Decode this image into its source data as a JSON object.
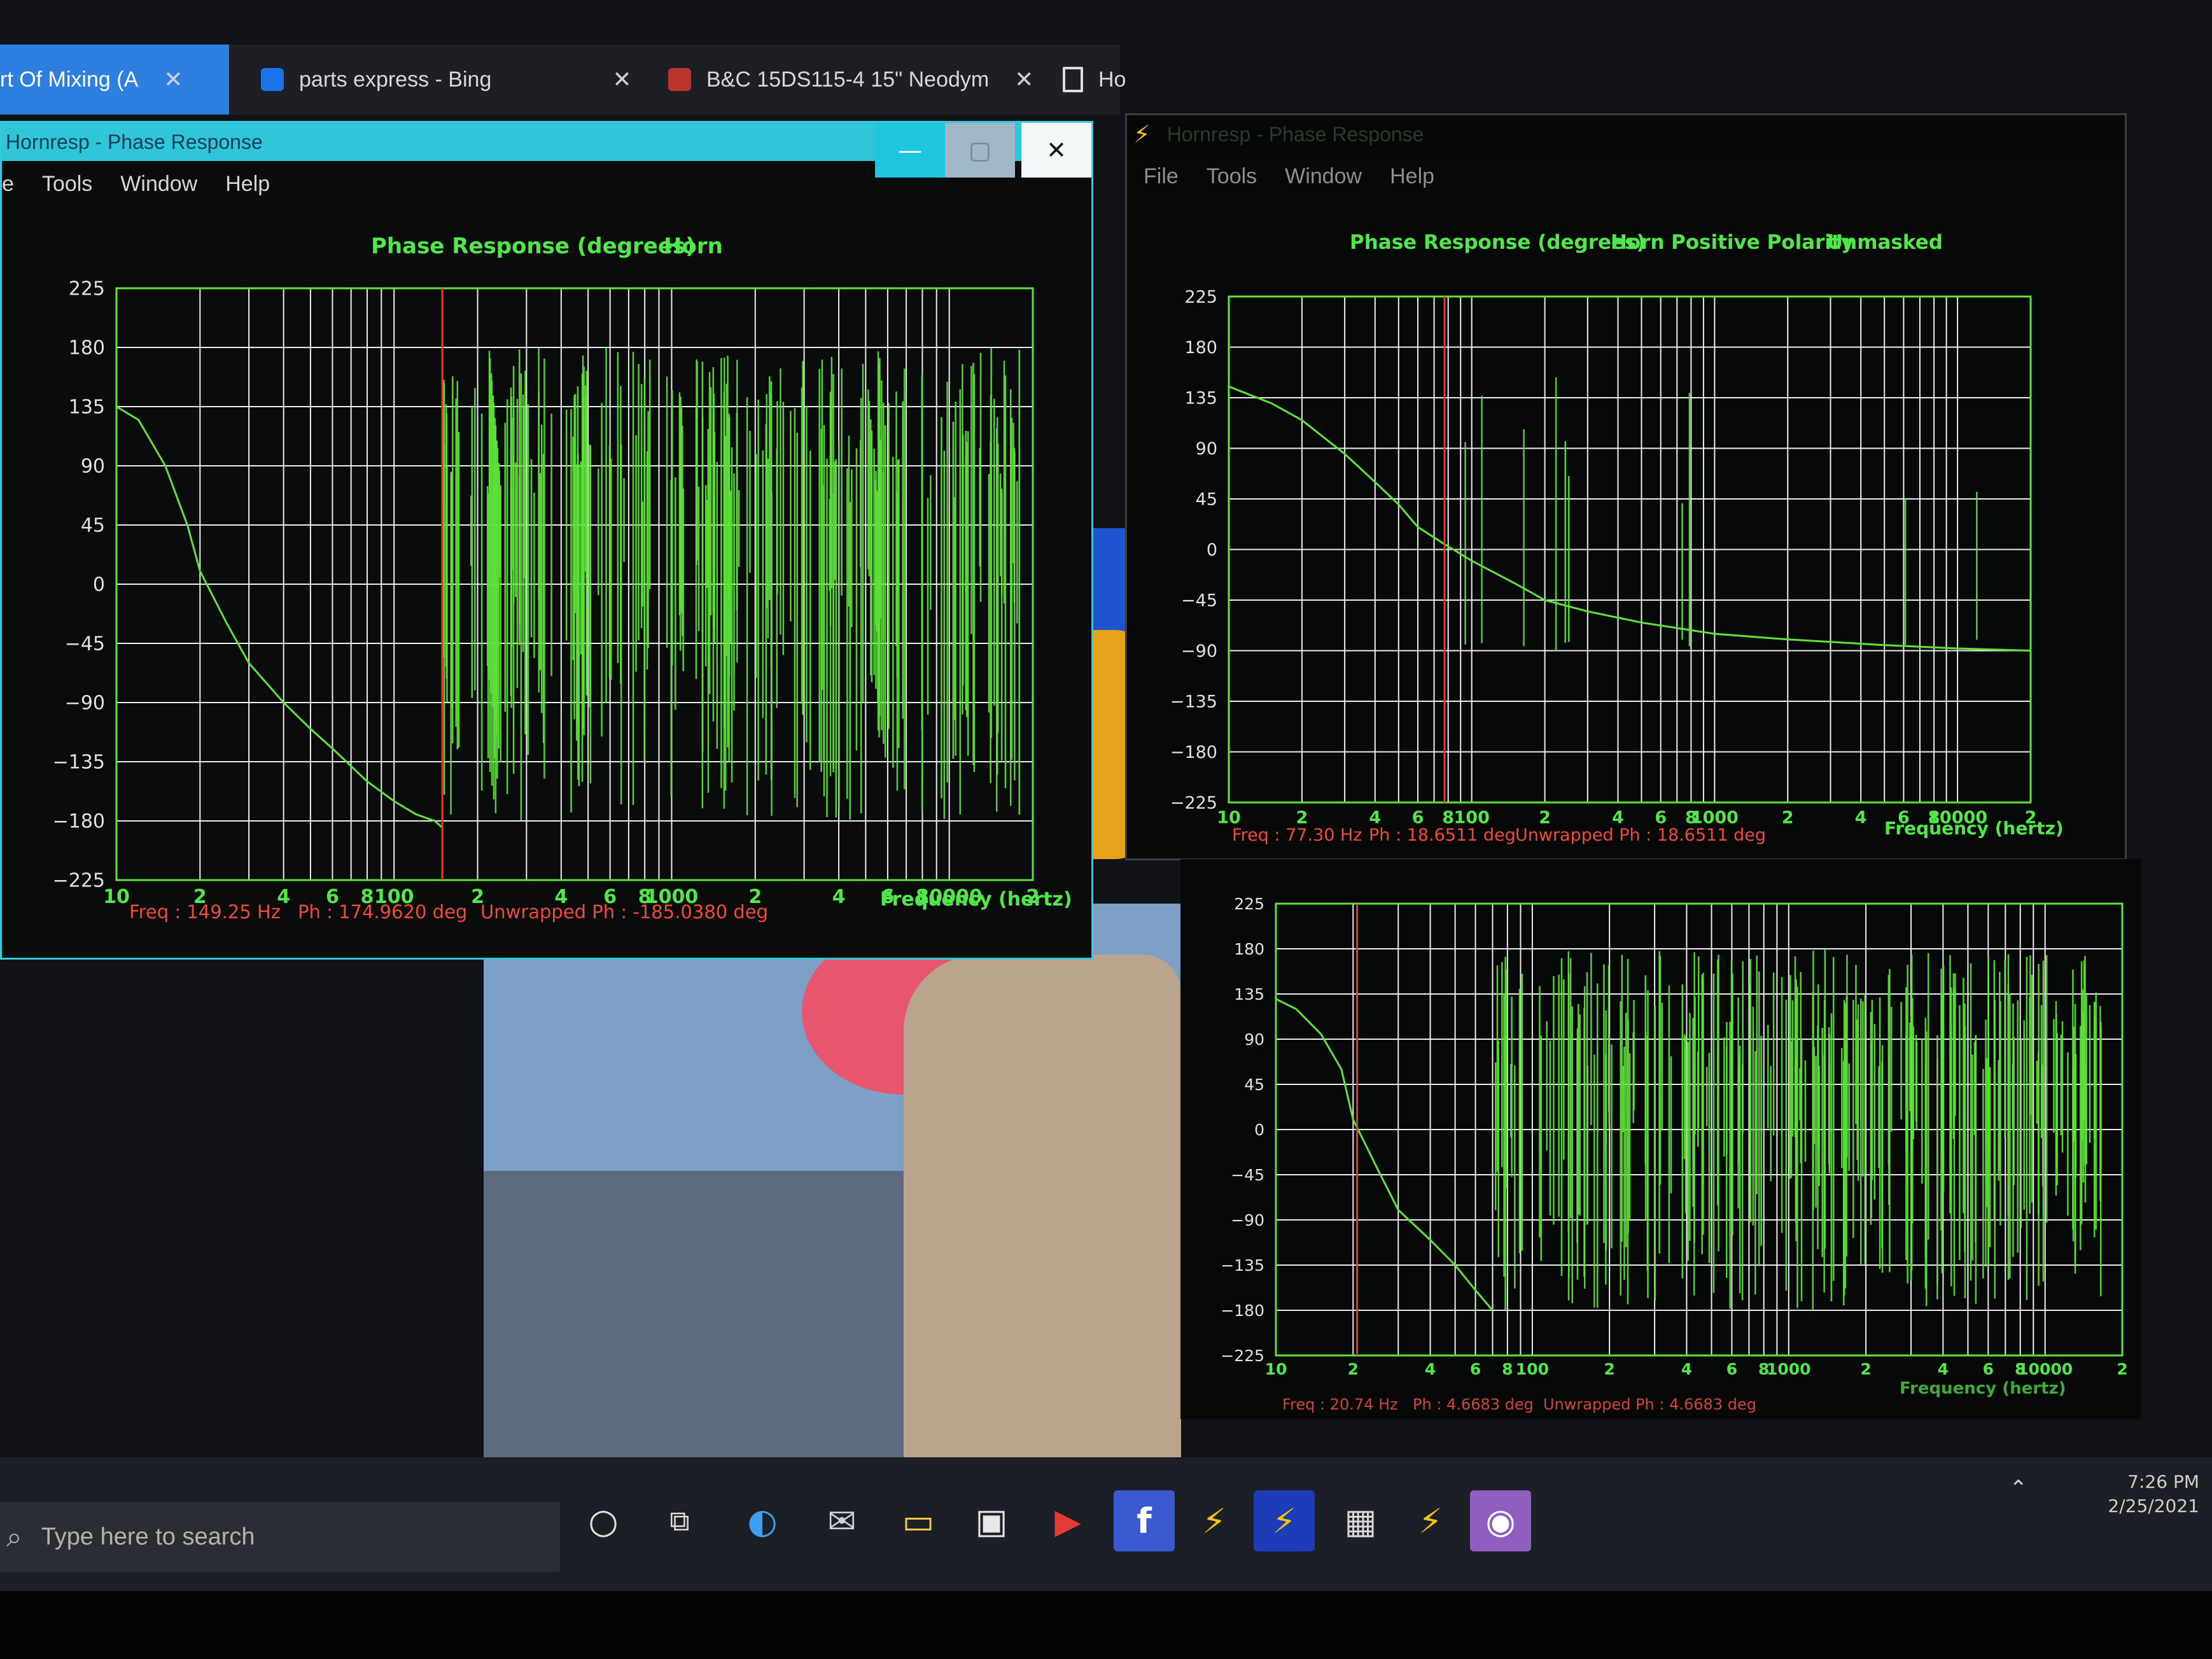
{
  "browser": {
    "tabs": [
      {
        "label": "rt Of Mixing (A",
        "close": "✕"
      },
      {
        "label": "parts express - Bing",
        "close": "✕"
      },
      {
        "label": "B&C 15DS115-4 15\" Neodym",
        "close": "✕"
      },
      {
        "label": "Ho"
      }
    ]
  },
  "left_window": {
    "title": "Hornresp - Phase Response",
    "controls": {
      "minimize": "—",
      "maximize": "▢",
      "close": "✕"
    },
    "menu": [
      "e",
      "Tools",
      "Window",
      "Help"
    ],
    "chart_title": "Phase Response (degrees)",
    "chart_tag": "Horn",
    "x_axis_label": "Frequency (hertz)",
    "readout": {
      "freq": "Freq : 149.25 Hz",
      "ph": "Ph : 174.9620 deg",
      "unwrapped": "Unwrapped Ph : -185.0380 deg"
    }
  },
  "right_window": {
    "title": "Hornresp - Phase Response",
    "menu": [
      "File",
      "Tools",
      "Window",
      "Help"
    ],
    "chart_title": "Phase Response (degrees)",
    "chart_tag": "Horn",
    "polarity": "Positive Polarity",
    "mask": "Unmasked",
    "x_axis_label": "Frequency (hertz)",
    "readout": {
      "freq": "Freq : 77.30 Hz",
      "ph": "Ph : 18.6511 deg",
      "unwrapped": "Unwrapped Ph : 18.6511 deg"
    }
  },
  "bottom_window": {
    "x_axis_label": "Frequency (hertz)",
    "readout": {
      "freq": "Freq : 20.74 Hz",
      "ph": "Ph : 4.6683 deg",
      "unwrapped": "Unwrapped Ph : 4.6683 deg"
    }
  },
  "taskbar": {
    "search_placeholder": "Type here to search",
    "time": "7:26 PM",
    "date": "2/25/2021",
    "icons": [
      "cortana-circle-icon",
      "task-view-icon",
      "edge-icon",
      "mail-icon",
      "file-explorer-icon",
      "store-icon",
      "youtube-icon",
      "facebook-icon",
      "hornresp-icon",
      "hornresp-active-icon",
      "calculator-icon",
      "hornresp-alt-icon",
      "search-app-icon"
    ]
  },
  "colors": {
    "grid": "#e9eeea",
    "axis_text": "#e0e0e0",
    "trace": "#5fe33a",
    "cursor": "#e23b2a",
    "title_green": "#51e64a",
    "readout_red": "#f04a3a"
  },
  "chart_data": [
    {
      "type": "line",
      "title": "Phase Response (degrees)",
      "xlabel": "Frequency (hertz)",
      "ylabel": "",
      "x_scale": "log",
      "xlim": [
        10,
        20000
      ],
      "ylim": [
        -225,
        225
      ],
      "y_ticks": [
        225,
        180,
        135,
        90,
        45,
        0,
        -45,
        -90,
        -135,
        -180,
        -225
      ],
      "x_tick_labels": [
        "10",
        "2",
        "4",
        "6",
        "8",
        "100",
        "2",
        "4",
        "6",
        "8",
        "1000",
        "2",
        "4",
        "6",
        "8",
        "10000",
        "2"
      ],
      "cursor_freq": 149.25,
      "series": [
        {
          "x": [
            10,
            12,
            15,
            18,
            20,
            25,
            30,
            40,
            50,
            60,
            80,
            100,
            120,
            140,
            149
          ],
          "y": [
            135,
            125,
            90,
            45,
            10,
            -30,
            -60,
            -90,
            -110,
            -125,
            -150,
            -165,
            -175,
            -180,
            -185
          ]
        }
      ]
    },
    {
      "type": "line",
      "title": "Phase Response (degrees)",
      "xlabel": "Frequency (hertz)",
      "ylabel": "",
      "x_scale": "log",
      "xlim": [
        10,
        20000
      ],
      "ylim": [
        -225,
        225
      ],
      "y_ticks": [
        225,
        180,
        135,
        90,
        45,
        0,
        -45,
        -90,
        -135,
        -180,
        -225
      ],
      "x_tick_labels": [
        "10",
        "2",
        "4",
        "6",
        "8",
        "100",
        "2",
        "4",
        "6",
        "8",
        "1000",
        "2",
        "4",
        "6",
        "8",
        "10000",
        "2"
      ],
      "cursor_freq": 77.3,
      "series": [
        {
          "x": [
            10,
            15,
            20,
            30,
            40,
            50,
            60,
            77,
            100,
            150,
            200,
            300,
            500,
            1000,
            2000,
            5000,
            10000,
            20000
          ],
          "y": [
            145,
            130,
            115,
            85,
            60,
            40,
            20,
            5,
            -10,
            -30,
            -45,
            -55,
            -65,
            -75,
            -80,
            -85,
            -88,
            -90
          ]
        }
      ]
    },
    {
      "type": "line",
      "title": "",
      "xlabel": "Frequency (hertz)",
      "ylabel": "",
      "x_scale": "log",
      "xlim": [
        10,
        20000
      ],
      "ylim": [
        -225,
        225
      ],
      "y_ticks": [
        225,
        180,
        135,
        90,
        45,
        0,
        -45,
        -90,
        -135,
        -180,
        -225
      ],
      "x_tick_labels": [
        "10",
        "2",
        "4",
        "6",
        "8",
        "100",
        "2",
        "4",
        "6",
        "8",
        "1000",
        "2",
        "4",
        "6",
        "8",
        "10000",
        "2"
      ],
      "cursor_freq": 20.74,
      "series": [
        {
          "x": [
            10,
            12,
            15,
            18,
            20,
            25,
            30,
            40,
            50,
            60,
            70
          ],
          "y": [
            130,
            120,
            95,
            60,
            10,
            -40,
            -80,
            -110,
            -135,
            -160,
            -180
          ]
        }
      ]
    }
  ]
}
